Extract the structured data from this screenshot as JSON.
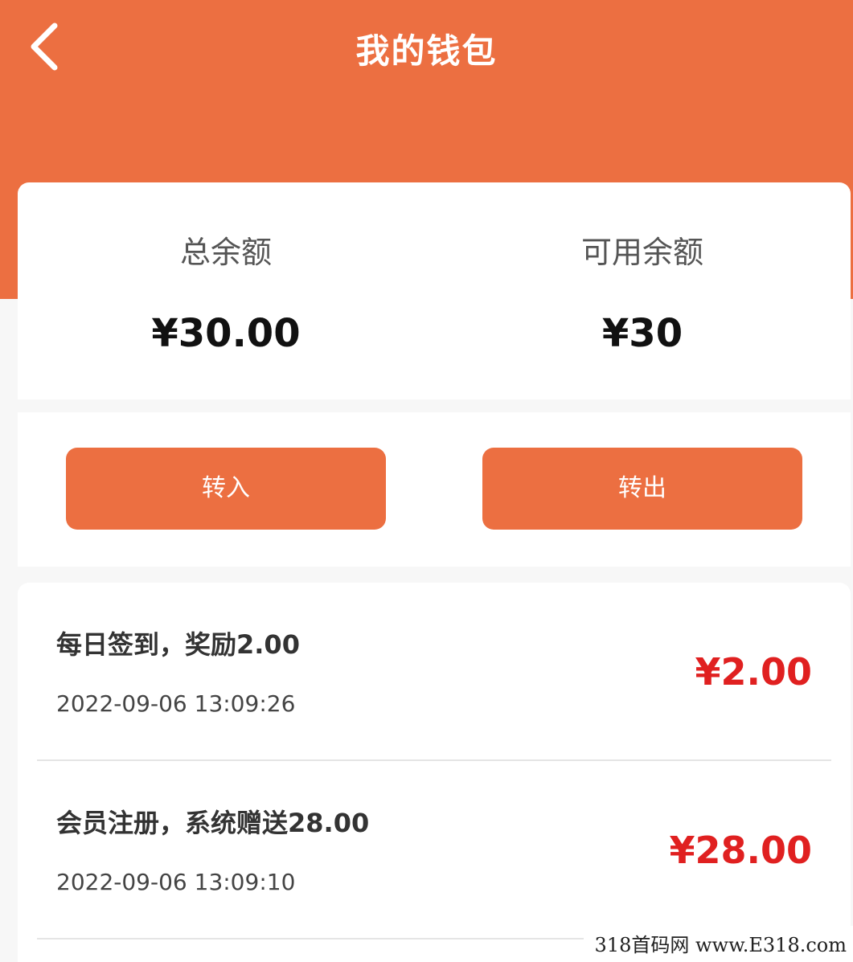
{
  "header": {
    "title": "我的钱包",
    "back_icon": "chevron-left-icon"
  },
  "balance": {
    "total_label": "总余额",
    "total_value": "¥30.00",
    "available_label": "可用余额",
    "available_value": "¥30"
  },
  "actions": {
    "transfer_in_label": "转入",
    "transfer_out_label": "转出"
  },
  "records": [
    {
      "title": "每日签到，奖励2.00",
      "time": "2022-09-06 13:09:26",
      "amount": "¥2.00"
    },
    {
      "title": "会员注册，系统赠送28.00",
      "time": "2022-09-06 13:09:10",
      "amount": "¥28.00"
    }
  ],
  "watermark": "318首码网 www.E318.com",
  "colors": {
    "brand": "#ec6f41",
    "amount": "#e02020",
    "background": "#f7f7f7"
  }
}
